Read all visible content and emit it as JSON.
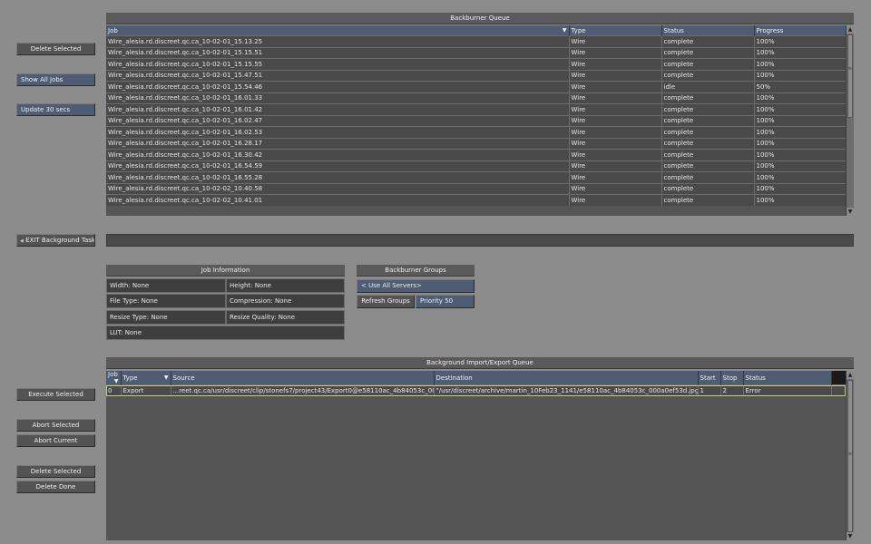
{
  "left_buttons": {
    "delete_selected": "Delete Selected",
    "show_all_jobs": "Show All Jobs",
    "update_interval": "Update 30 secs",
    "exit_background": "EXIT Background Tasks",
    "execute_selected": "Execute Selected",
    "abort_selected": "Abort Selected",
    "abort_current": "Abort Current",
    "delete_selected_2": "Delete Selected",
    "delete_done": "Delete Done"
  },
  "backburner_queue": {
    "title": "Backburner Queue",
    "columns": [
      "Job",
      "Type",
      "Status",
      "Progress"
    ],
    "rows": [
      {
        "job": "Wire_alesia.rd.discreet.qc.ca_10-02-01_15.13.25",
        "type": "Wire",
        "status": "complete",
        "progress": "100%"
      },
      {
        "job": "Wire_alesia.rd.discreet.qc.ca_10-02-01_15.15.51",
        "type": "Wire",
        "status": "complete",
        "progress": "100%"
      },
      {
        "job": "Wire_alesia.rd.discreet.qc.ca_10-02-01_15.15.55",
        "type": "Wire",
        "status": "complete",
        "progress": "100%"
      },
      {
        "job": "Wire_alesia.rd.discreet.qc.ca_10-02-01_15.47.51",
        "type": "Wire",
        "status": "complete",
        "progress": "100%"
      },
      {
        "job": "Wire_alesia.rd.discreet.qc.ca_10-02-01_15.54.46",
        "type": "Wire",
        "status": "idle",
        "progress": "50%"
      },
      {
        "job": "Wire_alesia.rd.discreet.qc.ca_10-02-01_16.01.33",
        "type": "Wire",
        "status": "complete",
        "progress": "100%"
      },
      {
        "job": "Wire_alesia.rd.discreet.qc.ca_10-02-01_16.01.42",
        "type": "Wire",
        "status": "complete",
        "progress": "100%"
      },
      {
        "job": "Wire_alesia.rd.discreet.qc.ca_10-02-01_16.02.47",
        "type": "Wire",
        "status": "complete",
        "progress": "100%"
      },
      {
        "job": "Wire_alesia.rd.discreet.qc.ca_10-02-01_16.02.53",
        "type": "Wire",
        "status": "complete",
        "progress": "100%"
      },
      {
        "job": "Wire_alesia.rd.discreet.qc.ca_10-02-01_16.28.17",
        "type": "Wire",
        "status": "complete",
        "progress": "100%"
      },
      {
        "job": "Wire_alesia.rd.discreet.qc.ca_10-02-01_16.30.42",
        "type": "Wire",
        "status": "complete",
        "progress": "100%"
      },
      {
        "job": "Wire_alesia.rd.discreet.qc.ca_10-02-01_16.54.59",
        "type": "Wire",
        "status": "complete",
        "progress": "100%"
      },
      {
        "job": "Wire_alesia.rd.discreet.qc.ca_10-02-01_16.55.28",
        "type": "Wire",
        "status": "complete",
        "progress": "100%"
      },
      {
        "job": "Wire_alesia.rd.discreet.qc.ca_10-02-02_10.40.58",
        "type": "Wire",
        "status": "complete",
        "progress": "100%"
      },
      {
        "job": "Wire_alesia.rd.discreet.qc.ca_10-02-02_10.41.01",
        "type": "Wire",
        "status": "complete",
        "progress": "100%"
      }
    ]
  },
  "job_information": {
    "title": "Job Information",
    "width": "Width: None",
    "height": "Height: None",
    "file_type": "File Type: None",
    "compression": "Compression: None",
    "resize_type": "Resize Type: None",
    "resize_quality": "Resize Quality: None",
    "lut": "LUT: None"
  },
  "backburner_groups": {
    "title": "Backburner Groups",
    "server": "< Use All Servers>",
    "refresh": "Refresh Groups",
    "priority": "Priority 50"
  },
  "import_export_queue": {
    "title": "Background Import/Export Queue",
    "columns": [
      "Job",
      "Type",
      "Source",
      "Destination",
      "Start",
      "Stop",
      "Status"
    ],
    "rows": [
      {
        "job": "0",
        "type": "Export",
        "source": "...reet.qc.ca/usr/discreet/clip/stonefs7/project43/Export0@e58110ac_4b84053c_000a0ef5\"",
        "destination": "\"/usr/discreet/archive/martin_10Feb23_1141/e58110ac_4b84053c_000a0ef53d.jpg\"",
        "start": "1",
        "stop": "2",
        "status": "Error"
      }
    ]
  }
}
